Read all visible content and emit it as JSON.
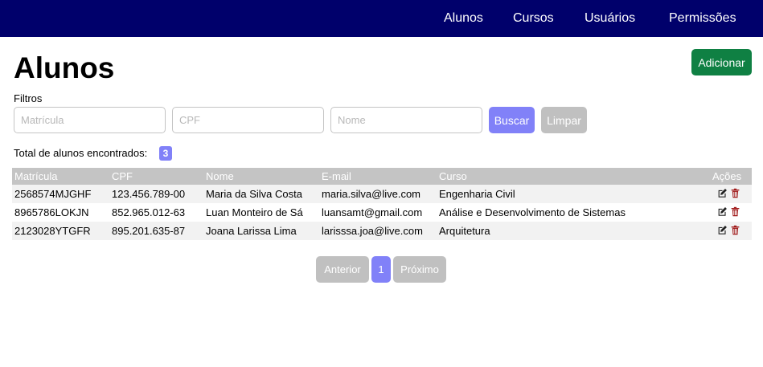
{
  "nav": {
    "items": [
      "Alunos",
      "Cursos",
      "Usuários",
      "Permissões"
    ]
  },
  "page": {
    "title": "Alunos",
    "add_label": "Adicionar"
  },
  "filters": {
    "label": "Filtros",
    "matricula_placeholder": "Matrícula",
    "cpf_placeholder": "CPF",
    "nome_placeholder": "Nome",
    "search_label": "Buscar",
    "clear_label": "Limpar"
  },
  "summary": {
    "total_label": "Total de alunos encontrados:",
    "total_count": "3"
  },
  "table": {
    "headers": [
      "Matrícula",
      "CPF",
      "Nome",
      "E-mail",
      "Curso",
      "Ações"
    ],
    "rows": [
      {
        "matricula": "2568574MJGHF",
        "cpf": "123.456.789-00",
        "nome": "Maria da Silva Costa",
        "email": "maria.silva@live.com",
        "curso": "Engenharia Civil"
      },
      {
        "matricula": "8965786LOKJN",
        "cpf": "852.965.012-63",
        "nome": "Luan Monteiro de Sá",
        "email": "luansamt@gmail.com",
        "curso": "Análise e Desenvolvimento de Sistemas"
      },
      {
        "matricula": "2123028YTGFR",
        "cpf": "895.201.635-87",
        "nome": "Joana Larissa Lima",
        "email": "larisssa.joa@live.com",
        "curso": "Arquitetura"
      }
    ],
    "edit_icon": "edit-icon",
    "delete_icon": "trash-icon"
  },
  "pagination": {
    "prev_label": "Anterior",
    "page_label": "1",
    "next_label": "Próximo"
  },
  "colors": {
    "navbar": "#00006b",
    "add_button": "#0f8043",
    "primary": "#8181f8",
    "disabled": "#c0c0c0",
    "delete_icon": "#a01818"
  }
}
